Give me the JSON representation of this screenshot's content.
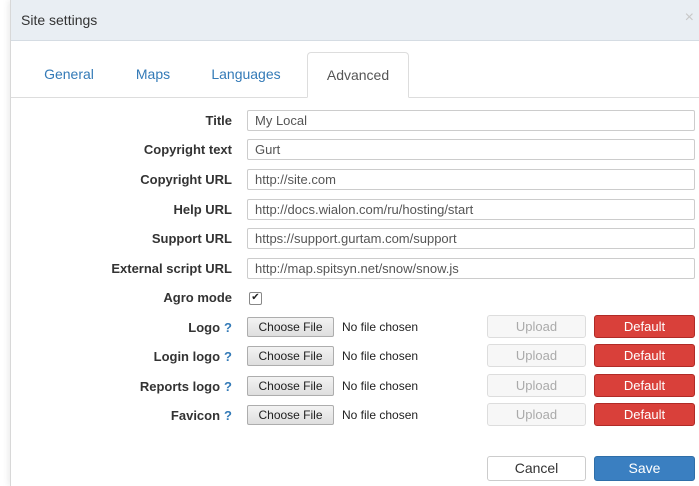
{
  "window": {
    "title": "Site settings",
    "close_glyph": "×"
  },
  "tabs": [
    {
      "label": "General"
    },
    {
      "label": "Maps"
    },
    {
      "label": "Languages"
    },
    {
      "label": "Advanced",
      "active": true
    }
  ],
  "fields": {
    "title": {
      "label": "Title",
      "value": "My Local"
    },
    "copyright_text": {
      "label": "Copyright text",
      "value": "Gurt"
    },
    "copyright_url": {
      "label": "Copyright URL",
      "value": "http://site.com"
    },
    "help_url": {
      "label": "Help URL",
      "value": "http://docs.wialon.com/ru/hosting/start"
    },
    "support_url": {
      "label": "Support URL",
      "value": "https://support.gurtam.com/support"
    },
    "external_script_url": {
      "label": "External script URL",
      "value": "http://map.spitsyn.net/snow/snow.js"
    },
    "agro_mode": {
      "label": "Agro mode",
      "checked": true,
      "check_glyph": "✔"
    }
  },
  "uploads": [
    {
      "label": "Logo",
      "help": "?",
      "choose_label": "Choose File",
      "file_status": "No file chosen",
      "upload_label": "Upload",
      "default_label": "Default"
    },
    {
      "label": "Login logo",
      "help": "?",
      "choose_label": "Choose File",
      "file_status": "No file chosen",
      "upload_label": "Upload",
      "default_label": "Default"
    },
    {
      "label": "Reports logo",
      "help": "?",
      "choose_label": "Choose File",
      "file_status": "No file chosen",
      "upload_label": "Upload",
      "default_label": "Default"
    },
    {
      "label": "Favicon",
      "help": "?",
      "choose_label": "Choose File",
      "file_status": "No file chosen",
      "upload_label": "Upload",
      "default_label": "Default"
    }
  ],
  "footer": {
    "cancel_label": "Cancel",
    "save_label": "Save"
  },
  "colors": {
    "accent": "#337ab7",
    "danger": "#d9403a",
    "primary": "#3a7fc1",
    "titlebar": "#e9eef3"
  }
}
